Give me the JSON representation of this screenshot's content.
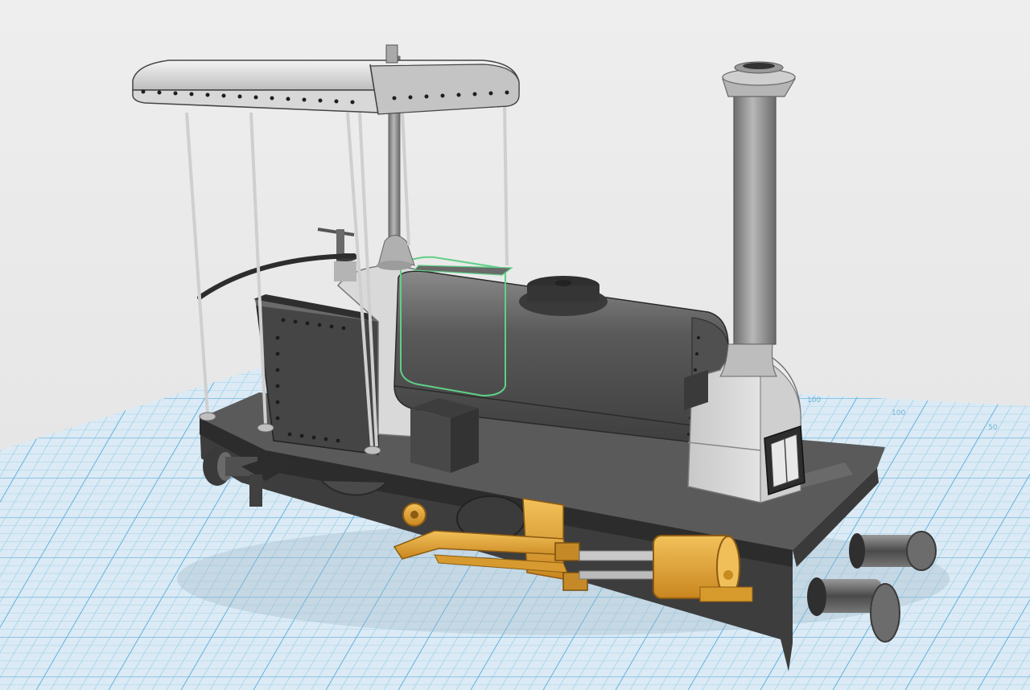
{
  "viewport": {
    "background": "#e6e6e6",
    "grid": {
      "fill": "#dcecf6",
      "line_color": "#7ec3e6",
      "major_line_color": "#57ade0",
      "labels": [
        "100",
        "100",
        "50"
      ]
    }
  },
  "model": {
    "body_color": "#4a4a4a",
    "light_color": "#d4d4d4",
    "brass_color": "#e0a437",
    "highlight_color": "#5fcf86"
  }
}
